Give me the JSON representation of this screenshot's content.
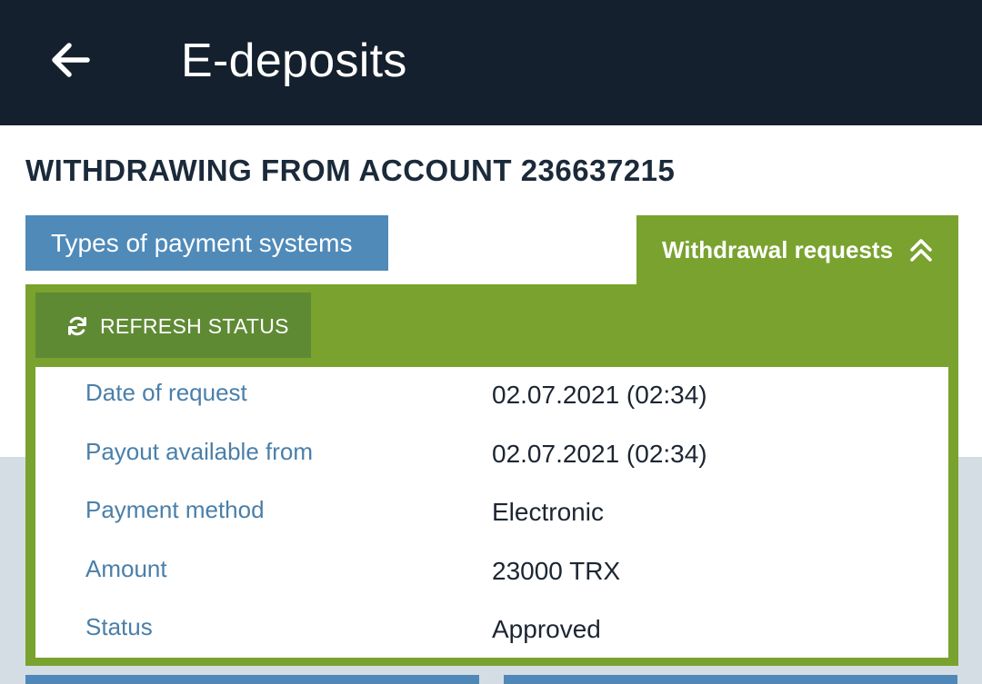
{
  "header": {
    "back_icon": "arrow-left-icon",
    "title": "E-deposits"
  },
  "section": {
    "title": "WITHDRAWING FROM ACCOUNT 236637215"
  },
  "tabs": {
    "payment_systems": "Types of payment systems",
    "withdrawal_requests": "Withdrawal requests",
    "withdrawal_icon": "chevron-double-up-icon"
  },
  "refresh": {
    "icon": "refresh-icon",
    "label": "REFRESH STATUS"
  },
  "request": [
    {
      "label": "Date of request",
      "value": "02.07.2021 (02:34)"
    },
    {
      "label": "Payout available from",
      "value": "02.07.2021 (02:34)"
    },
    {
      "label": "Payment method",
      "value": "Electronic"
    },
    {
      "label": "Amount",
      "value": "23000 TRX"
    },
    {
      "label": "Status",
      "value": "Approved"
    }
  ],
  "colors": {
    "header_bg": "#15202e",
    "tab_blue": "#4f8ab9",
    "panel_green": "#79a22f",
    "refresh_green": "#5f8a34",
    "label_blue": "#4a7fa9"
  }
}
